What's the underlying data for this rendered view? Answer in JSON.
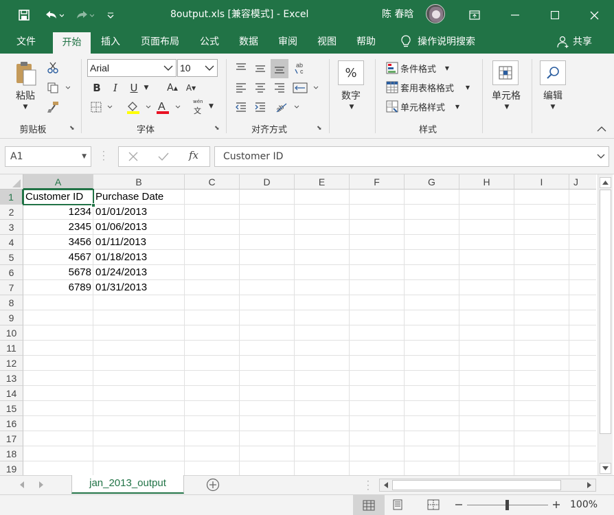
{
  "window": {
    "title": "8output.xls  [兼容模式]  -  Excel",
    "user": "陈 春晗"
  },
  "ribbon_tabs": [
    "文件",
    "开始",
    "插入",
    "页面布局",
    "公式",
    "数据",
    "审阅",
    "视图",
    "帮助"
  ],
  "tell_me": "操作说明搜索",
  "share": "共享",
  "clipboard": {
    "paste": "粘贴",
    "label": "剪贴板"
  },
  "font": {
    "name": "Arial",
    "size": "10",
    "label": "字体",
    "bold": "B",
    "italic": "I",
    "underline": "U",
    "grow": "A",
    "shrink": "A",
    "phonetic": "文",
    "font_color_letter": "A"
  },
  "alignment": {
    "label": "对齐方式"
  },
  "number": {
    "pct": "%",
    "label": "数字"
  },
  "styles": {
    "conditional": "条件格式",
    "table": "套用表格格式",
    "cell": "单元格样式",
    "label": "样式"
  },
  "cells": {
    "label": "单元格"
  },
  "editing": {
    "label": "编辑"
  },
  "formula_bar": {
    "name_box": "A1",
    "fx": "fx",
    "content": "Customer ID"
  },
  "columns": [
    "A",
    "B",
    "C",
    "D",
    "E",
    "F",
    "G",
    "H",
    "I",
    "J"
  ],
  "rows": [
    "1",
    "2",
    "3",
    "4",
    "5",
    "6",
    "7",
    "8",
    "9",
    "10",
    "11",
    "12",
    "13",
    "14",
    "15",
    "16",
    "17",
    "18",
    "19"
  ],
  "table": {
    "headers": [
      "Customer ID",
      "Purchase Date"
    ],
    "rows": [
      [
        "1234",
        "01/01/2013"
      ],
      [
        "2345",
        "01/06/2013"
      ],
      [
        "3456",
        "01/11/2013"
      ],
      [
        "4567",
        "01/18/2013"
      ],
      [
        "5678",
        "01/24/2013"
      ],
      [
        "6789",
        "01/31/2013"
      ]
    ]
  },
  "sheet_tab": "jan_2013_output",
  "zoom": "100%",
  "colors": {
    "accent": "#217346",
    "font_color": "#e81123",
    "highlight": "#ffff00"
  }
}
